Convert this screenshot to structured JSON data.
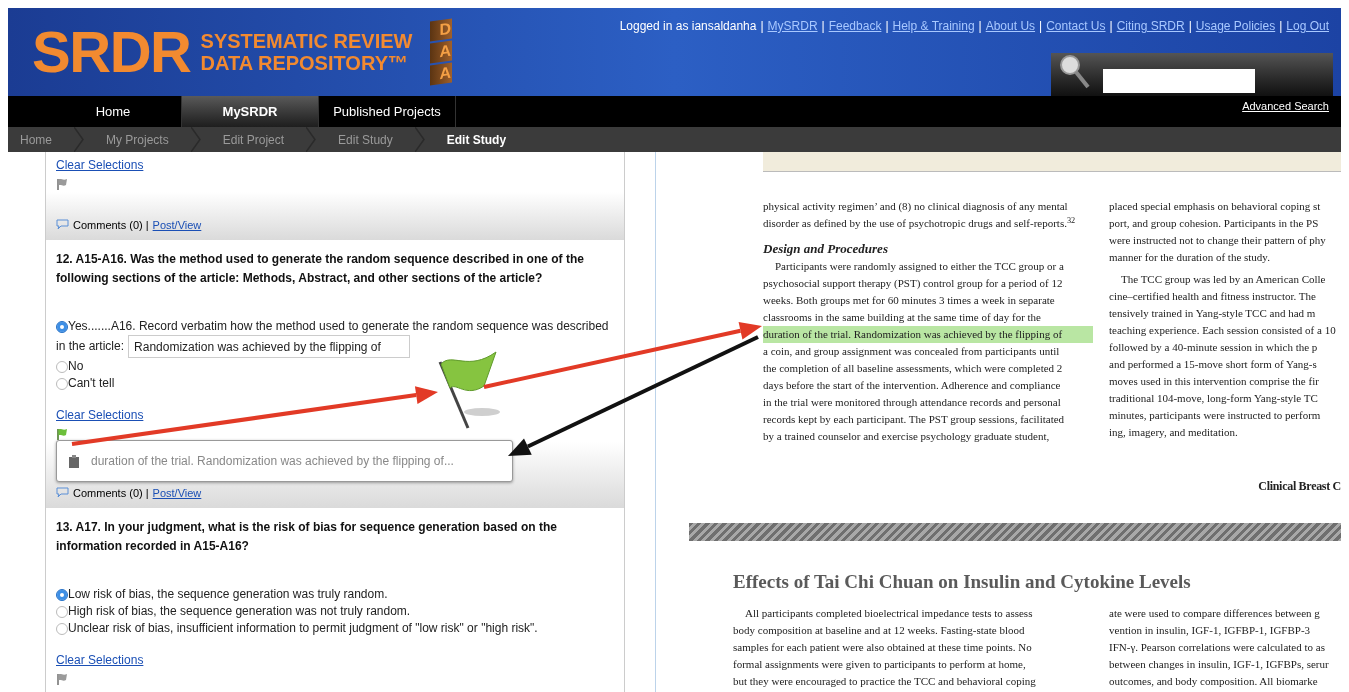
{
  "header": {
    "logo_text": "SRDR",
    "logo_tagline": [
      "SYSTEMATIC REVIEW",
      "DATA REPOSITORY™"
    ],
    "logo_letters": [
      "D",
      "A",
      "A"
    ],
    "user_text": "Logged in as iansaldanha",
    "separator": "|",
    "links": [
      "MySRDR",
      "Feedback",
      "Help & Training",
      "About Us",
      "Contact Us",
      "Citing SRDR",
      "Usage Policies",
      "Log Out"
    ],
    "advanced_search": "Advanced Search"
  },
  "nav": [
    {
      "label": "Home",
      "selected": false
    },
    {
      "label": "MySRDR",
      "selected": true
    },
    {
      "label": "Published Projects",
      "selected": false
    }
  ],
  "breadcrumbs": [
    {
      "label": "Home",
      "current": false
    },
    {
      "label": "My Projects",
      "current": false
    },
    {
      "label": "Edit Project",
      "current": false
    },
    {
      "label": "Edit Study",
      "current": false
    },
    {
      "label": "Edit Study",
      "current": true
    }
  ],
  "form": [
    {
      "clear": "Clear Selections",
      "flagged": false,
      "comments": "Comments (0) |",
      "post_view": "Post/View"
    },
    {
      "title": "12. A15-A16. Was the method used to generate the random sequence described in one of the following sections of the article: Methods, Abstract, and other sections of the article?",
      "options": [
        {
          "label": "Yes.......A16. Record verbatim how the method used to generate the random sequence was described",
          "selected": true,
          "field_label": "in the article:",
          "field_value": "Randomization was achieved by the flipping of"
        },
        {
          "label": "No",
          "selected": false
        },
        {
          "label": "Can't tell",
          "selected": false
        }
      ],
      "clear": "Clear Selections",
      "flagged": true,
      "tooltip": "duration of the trial. Randomization was achieved by the flipping of...",
      "comments": "Comments (0) |",
      "post_view": "Post/View"
    },
    {
      "title": "13. A17. In your judgment, what is the risk of bias for sequence generation based on the information recorded in A15-A16?",
      "options": [
        {
          "label": "Low risk of bias, the sequence generation was truly random.",
          "selected": true
        },
        {
          "label": "High risk of bias, the sequence generation was not truly random.",
          "selected": false
        },
        {
          "label": "Unclear risk of bias, insufficient information to permit judgment of \"low risk\" or \"high risk\".",
          "selected": false
        }
      ],
      "clear": "Clear Selections",
      "flagged": false
    }
  ],
  "article": {
    "left": [
      {
        "kind": "paragraph",
        "lines": [
          {
            "text": "physical activity regimen’ and (8) no clinical diagnosis of any mental",
            "highlighted": false
          },
          {
            "text": "disorder as defined by the use of psychotropic drugs and self-reports.$^{32}$",
            "highlighted": false
          }
        ]
      },
      {
        "kind": "heading",
        "text": "Design and Procedures"
      },
      {
        "kind": "paragraph",
        "indent": true,
        "lines": [
          {
            "text": "Participants were randomly assigned to either the TCC group or a",
            "highlighted": false
          },
          {
            "text": "psychosocial support therapy (PST) control group for a period of 12",
            "highlighted": false
          },
          {
            "text": "weeks. Both groups met for 60 minutes 3 times a week in separate",
            "highlighted": false
          },
          {
            "text": "classrooms in the same building at the same time of day for the",
            "highlighted": false
          },
          {
            "text": "duration of the trial. Randomization was achieved by the flipping of",
            "highlighted": true
          },
          {
            "text": "a coin, and group assignment was concealed from participants until",
            "highlighted": false
          },
          {
            "text": "the completion of all baseline assessments, which were completed 2",
            "highlighted": false
          },
          {
            "text": "days before the start of the intervention. Adherence and compliance",
            "highlighted": false
          },
          {
            "text": "in the trial were monitored through attendance records and personal",
            "highlighted": false
          },
          {
            "text": "records kept by each participant. The PST group sessions, facilitated",
            "highlighted": false
          },
          {
            "text": "by a trained counselor and exercise psychology graduate student,",
            "highlighted": false
          }
        ]
      }
    ],
    "right": [
      {
        "kind": "paragraph",
        "lines": [
          {
            "text": "placed special emphasis on behavioral coping st"
          },
          {
            "text": "port, and group cohesion. Participants in the PS"
          },
          {
            "text": "were instructed not to change their pattern of phy"
          },
          {
            "text": "manner for the duration of the study."
          }
        ]
      },
      {
        "kind": "paragraph",
        "indent": true,
        "lines": [
          {
            "text": "The TCC group was led by an American Colle"
          },
          {
            "text": "cine–certified health and fitness instructor. The"
          },
          {
            "text": "tensively trained in Yang-style TCC and had m"
          },
          {
            "text": "teaching experience. Each session consisted of a 10"
          },
          {
            "text": "followed by a 40-minute session in which the p"
          },
          {
            "text": "and performed a 15-move short form of Yang-s"
          },
          {
            "text": "moves used in this intervention comprise the fir"
          },
          {
            "text": "traditional 104-move, long-form Yang-style TC"
          },
          {
            "text": "minutes, participants were instructed to perform"
          },
          {
            "text": "ing, imagery, and meditation."
          }
        ]
      }
    ],
    "running_footer": "Clinical Breast C",
    "section_heading": "Effects of Tai Chi Chuan on Insulin and Cytokine Levels",
    "bottom_left": [
      {
        "kind": "paragraph",
        "indent": true,
        "lines": [
          {
            "text": "All participants completed bioelectrical impedance tests to assess"
          },
          {
            "text": "body composition at baseline and at 12 weeks. Fasting-state blood"
          },
          {
            "text": "samples for each patient were also obtained at these time points. No"
          },
          {
            "text": "formal assignments were given to participants to perform at home,"
          },
          {
            "text": "but they were encouraged to practice the TCC and behavioral coping"
          }
        ]
      }
    ],
    "bottom_right": [
      {
        "kind": "paragraph",
        "lines": [
          {
            "text": "ate were used to compare differences between g"
          },
          {
            "text": "vention in insulin, IGF-1, IGFBP-1, IGFBP-3"
          },
          {
            "text": "IFN-γ. Pearson correlations were calculated to as"
          },
          {
            "text": "between changes in insulin, IGF-1, IGFBPs, serur"
          },
          {
            "text": "outcomes, and body composition. All biomarke"
          }
        ]
      }
    ]
  }
}
